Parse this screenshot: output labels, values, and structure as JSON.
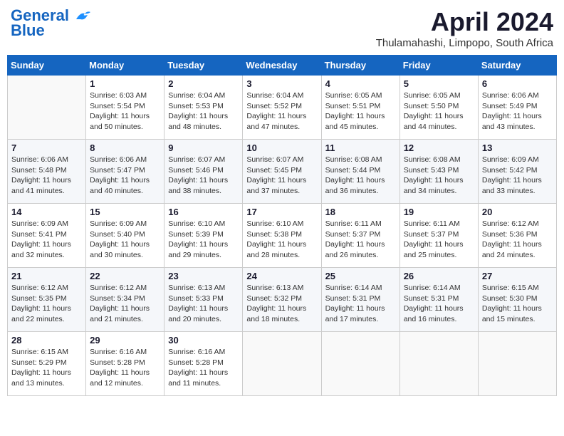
{
  "header": {
    "logo_line1": "General",
    "logo_line2": "Blue",
    "month_year": "April 2024",
    "location": "Thulamahashi, Limpopo, South Africa"
  },
  "weekdays": [
    "Sunday",
    "Monday",
    "Tuesday",
    "Wednesday",
    "Thursday",
    "Friday",
    "Saturday"
  ],
  "weeks": [
    [
      {
        "day": "",
        "detail": ""
      },
      {
        "day": "1",
        "detail": "Sunrise: 6:03 AM\nSunset: 5:54 PM\nDaylight: 11 hours\nand 50 minutes."
      },
      {
        "day": "2",
        "detail": "Sunrise: 6:04 AM\nSunset: 5:53 PM\nDaylight: 11 hours\nand 48 minutes."
      },
      {
        "day": "3",
        "detail": "Sunrise: 6:04 AM\nSunset: 5:52 PM\nDaylight: 11 hours\nand 47 minutes."
      },
      {
        "day": "4",
        "detail": "Sunrise: 6:05 AM\nSunset: 5:51 PM\nDaylight: 11 hours\nand 45 minutes."
      },
      {
        "day": "5",
        "detail": "Sunrise: 6:05 AM\nSunset: 5:50 PM\nDaylight: 11 hours\nand 44 minutes."
      },
      {
        "day": "6",
        "detail": "Sunrise: 6:06 AM\nSunset: 5:49 PM\nDaylight: 11 hours\nand 43 minutes."
      }
    ],
    [
      {
        "day": "7",
        "detail": "Sunrise: 6:06 AM\nSunset: 5:48 PM\nDaylight: 11 hours\nand 41 minutes."
      },
      {
        "day": "8",
        "detail": "Sunrise: 6:06 AM\nSunset: 5:47 PM\nDaylight: 11 hours\nand 40 minutes."
      },
      {
        "day": "9",
        "detail": "Sunrise: 6:07 AM\nSunset: 5:46 PM\nDaylight: 11 hours\nand 38 minutes."
      },
      {
        "day": "10",
        "detail": "Sunrise: 6:07 AM\nSunset: 5:45 PM\nDaylight: 11 hours\nand 37 minutes."
      },
      {
        "day": "11",
        "detail": "Sunrise: 6:08 AM\nSunset: 5:44 PM\nDaylight: 11 hours\nand 36 minutes."
      },
      {
        "day": "12",
        "detail": "Sunrise: 6:08 AM\nSunset: 5:43 PM\nDaylight: 11 hours\nand 34 minutes."
      },
      {
        "day": "13",
        "detail": "Sunrise: 6:09 AM\nSunset: 5:42 PM\nDaylight: 11 hours\nand 33 minutes."
      }
    ],
    [
      {
        "day": "14",
        "detail": "Sunrise: 6:09 AM\nSunset: 5:41 PM\nDaylight: 11 hours\nand 32 minutes."
      },
      {
        "day": "15",
        "detail": "Sunrise: 6:09 AM\nSunset: 5:40 PM\nDaylight: 11 hours\nand 30 minutes."
      },
      {
        "day": "16",
        "detail": "Sunrise: 6:10 AM\nSunset: 5:39 PM\nDaylight: 11 hours\nand 29 minutes."
      },
      {
        "day": "17",
        "detail": "Sunrise: 6:10 AM\nSunset: 5:38 PM\nDaylight: 11 hours\nand 28 minutes."
      },
      {
        "day": "18",
        "detail": "Sunrise: 6:11 AM\nSunset: 5:37 PM\nDaylight: 11 hours\nand 26 minutes."
      },
      {
        "day": "19",
        "detail": "Sunrise: 6:11 AM\nSunset: 5:37 PM\nDaylight: 11 hours\nand 25 minutes."
      },
      {
        "day": "20",
        "detail": "Sunrise: 6:12 AM\nSunset: 5:36 PM\nDaylight: 11 hours\nand 24 minutes."
      }
    ],
    [
      {
        "day": "21",
        "detail": "Sunrise: 6:12 AM\nSunset: 5:35 PM\nDaylight: 11 hours\nand 22 minutes."
      },
      {
        "day": "22",
        "detail": "Sunrise: 6:12 AM\nSunset: 5:34 PM\nDaylight: 11 hours\nand 21 minutes."
      },
      {
        "day": "23",
        "detail": "Sunrise: 6:13 AM\nSunset: 5:33 PM\nDaylight: 11 hours\nand 20 minutes."
      },
      {
        "day": "24",
        "detail": "Sunrise: 6:13 AM\nSunset: 5:32 PM\nDaylight: 11 hours\nand 18 minutes."
      },
      {
        "day": "25",
        "detail": "Sunrise: 6:14 AM\nSunset: 5:31 PM\nDaylight: 11 hours\nand 17 minutes."
      },
      {
        "day": "26",
        "detail": "Sunrise: 6:14 AM\nSunset: 5:31 PM\nDaylight: 11 hours\nand 16 minutes."
      },
      {
        "day": "27",
        "detail": "Sunrise: 6:15 AM\nSunset: 5:30 PM\nDaylight: 11 hours\nand 15 minutes."
      }
    ],
    [
      {
        "day": "28",
        "detail": "Sunrise: 6:15 AM\nSunset: 5:29 PM\nDaylight: 11 hours\nand 13 minutes."
      },
      {
        "day": "29",
        "detail": "Sunrise: 6:16 AM\nSunset: 5:28 PM\nDaylight: 11 hours\nand 12 minutes."
      },
      {
        "day": "30",
        "detail": "Sunrise: 6:16 AM\nSunset: 5:28 PM\nDaylight: 11 hours\nand 11 minutes."
      },
      {
        "day": "",
        "detail": ""
      },
      {
        "day": "",
        "detail": ""
      },
      {
        "day": "",
        "detail": ""
      },
      {
        "day": "",
        "detail": ""
      }
    ]
  ]
}
